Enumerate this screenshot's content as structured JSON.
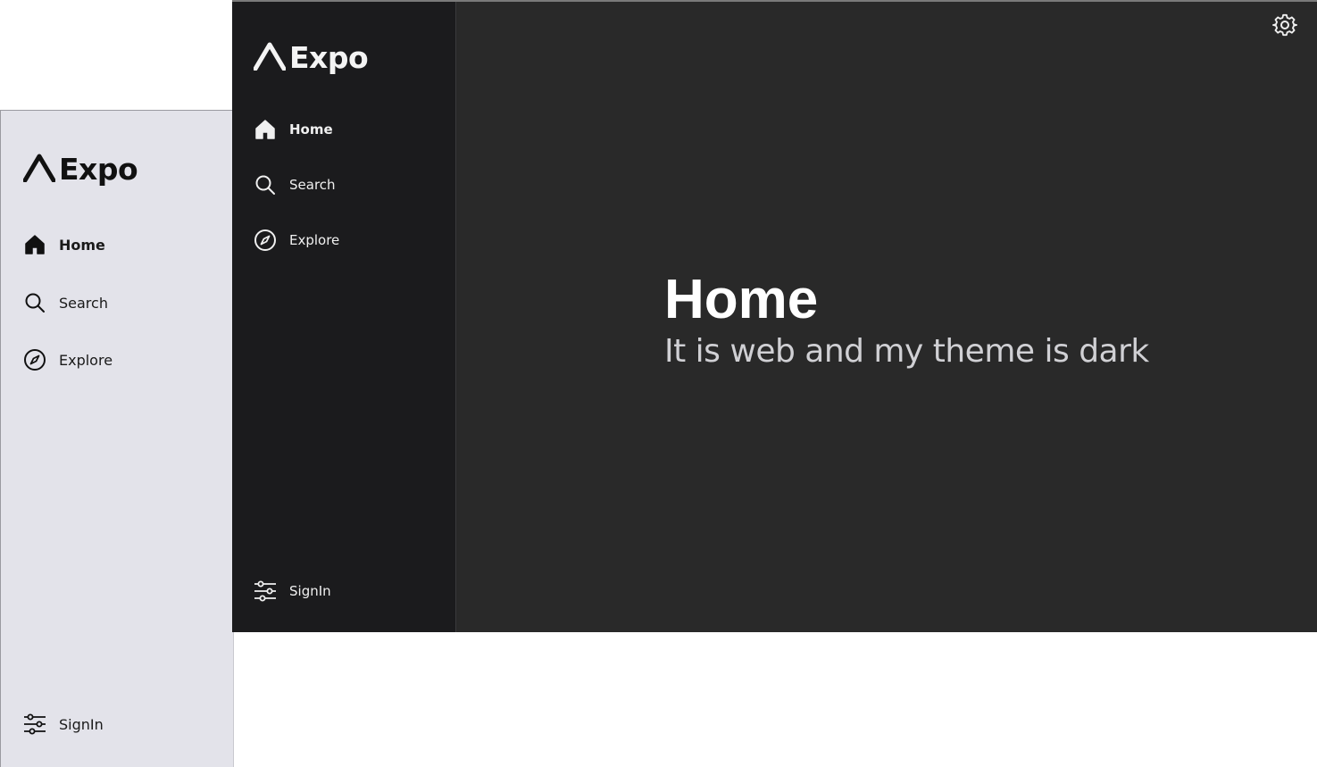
{
  "light_window": {
    "logo_text": "Expo",
    "nav": {
      "home": {
        "label": "Home",
        "icon": "home-icon"
      },
      "search": {
        "label": "Search",
        "icon": "search-icon"
      },
      "explore": {
        "label": "Explore",
        "icon": "compass-icon"
      }
    },
    "footer": {
      "label": "SignIn",
      "icon": "sliders-icon"
    },
    "theme": {
      "background": "#e3e3ea",
      "text": "#1a1a1a"
    }
  },
  "dark_window": {
    "logo_text": "Expo",
    "nav": {
      "home": {
        "label": "Home",
        "icon": "home-icon"
      },
      "search": {
        "label": "Search",
        "icon": "search-icon"
      },
      "explore": {
        "label": "Explore",
        "icon": "compass-icon"
      }
    },
    "footer": {
      "label": "SignIn",
      "icon": "sliders-icon"
    },
    "settings_icon": "gear-icon",
    "main": {
      "title": "Home",
      "subtitle": "It is web and my theme is dark"
    },
    "theme": {
      "sidebar": "#1b1b1d",
      "background": "#292929",
      "text": "#ffffff"
    }
  }
}
